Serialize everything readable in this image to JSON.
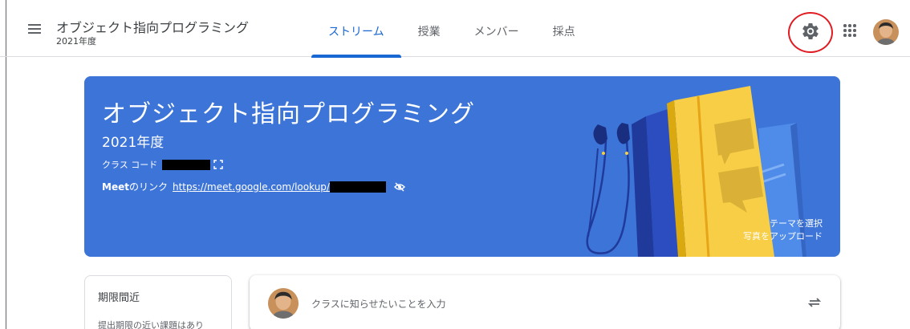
{
  "header": {
    "class_title": "オブジェクト指向プログラミング",
    "class_subtitle": "2021年度",
    "tabs": [
      {
        "label": "ストリーム",
        "active": true
      },
      {
        "label": "授業",
        "active": false
      },
      {
        "label": "メンバー",
        "active": false
      },
      {
        "label": "採点",
        "active": false
      }
    ],
    "icons": {
      "menu": "hamburger-menu-icon",
      "settings": "gear-icon",
      "apps": "apps-grid-icon",
      "account": "avatar"
    }
  },
  "banner": {
    "title": "オブジェクト指向プログラミング",
    "section": "2021年度",
    "class_code_label": "クラス コード",
    "meet_label_bold": "Meet",
    "meet_label_rest": "のリンク",
    "meet_link": "https://meet.google.com/lookup/",
    "select_theme": "テーマを選択",
    "upload_photo": "写真をアップロード",
    "color": "#3d74d8"
  },
  "deadlines": {
    "title": "期限間近",
    "body": "提出期限の近い課題はあり"
  },
  "announce": {
    "placeholder": "クラスに知らせたいことを入力"
  },
  "colors": {
    "accent": "#1967d2",
    "highlight_circle": "#e01b22"
  }
}
